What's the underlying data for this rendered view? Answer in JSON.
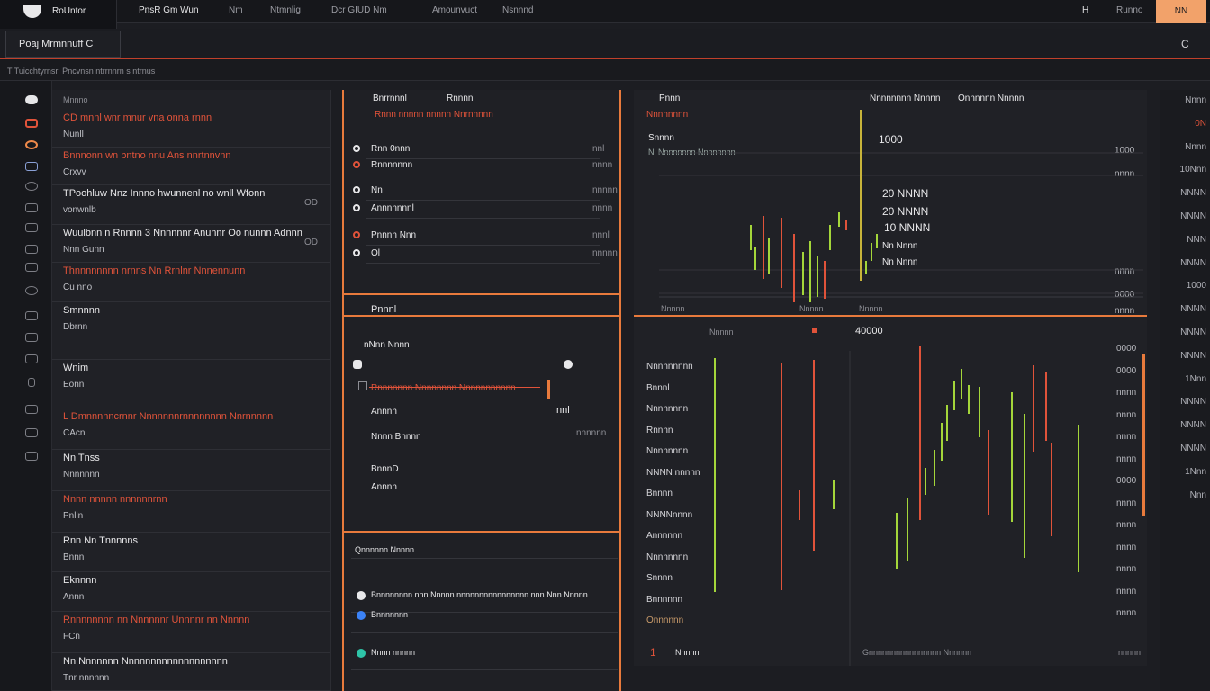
{
  "app": {
    "brand": "RoUntor",
    "user_button": "NN"
  },
  "nav": {
    "items": [
      "PnsR Gm Wun",
      "Nm",
      "Ntmnlig",
      "Dcr GIUD Nm",
      "Amounvuct",
      "Nsnnnd"
    ],
    "arrow": "H",
    "login": "Runno"
  },
  "symbol": {
    "label": "Poaj Mrmnnuff C",
    "close": "C"
  },
  "breadcrumb": "T Tuicchtyrnsr| Pncvnsn ntrrnnrn s ntrnus",
  "watchlist": {
    "header": "Mnnno",
    "rows": [
      {
        "title": "CD mnnl wnr mnur vna onna rnnn",
        "sub": "Nunll",
        "title_color": "red"
      },
      {
        "title": "Bnnnonn wn bntno nnu Ans nnrtnnvnn",
        "sub": "Crxvv",
        "title_color": "red"
      },
      {
        "title": "TPoohluw Nnz Innno hwunnenl no wnll Wfonn",
        "sub": "vonwnlb",
        "title_color": "wh"
      },
      {
        "title": "Wuulbnn n Rnnnn 3 Nnnnnnr Anunnr Oo nunnn Adnnn",
        "sub": "Nnn Gunn",
        "title_color": "wh"
      },
      {
        "title": "Thnnnnnnnn nrnns Nn Rrnlnr Nnnennunn",
        "sub": "Cu nno",
        "title_color": "red"
      },
      {
        "title": "Smnnnn",
        "sub": "Dbrnn",
        "title_color": "wh"
      },
      {
        "title": "Wnim",
        "sub": "Eonn",
        "title_color": "wh"
      },
      {
        "title": "L Dmnnnnncrnnr Nnnnnnnrnnnnnnnn Nnrnnnnn",
        "sub": "CAcn",
        "title_color": "red"
      },
      {
        "title": "Nn Tnss",
        "sub": "Nnnnnnn",
        "title_color": "wh"
      },
      {
        "title": "Nnnn nnnnn nnnnnnrnn",
        "sub": "Pnlln",
        "title_color": "red"
      },
      {
        "title": "Rnn Nn Tnnnnns",
        "sub": "Bnnn",
        "title_color": "wh"
      },
      {
        "title": "Eknnnn",
        "sub": "Annn",
        "title_color": "wh"
      },
      {
        "title": "Rnnnnnnnn nn Nnnnnnr Unnnnr nn Nnnnn",
        "sub": "FCn",
        "title_color": "red"
      },
      {
        "title": "Nn Nnnnnnn Nnnnnnnnnnnnnnnnnnn",
        "sub": "Tnr nnnnnn",
        "title_color": "wh"
      }
    ],
    "row_values": [
      "OD",
      "OD"
    ]
  },
  "orderbook": {
    "top_header": [
      "Bnrrnnnl",
      "Rnnnn"
    ],
    "alert": "Rnnn nnnnn nnnnn Nnrnnnnn",
    "items": [
      {
        "name": "Rnn 0nnn",
        "val": "nnl"
      },
      {
        "name": "Rnnnnnnn",
        "val": "nnnn"
      },
      {
        "name": "Nn",
        "val": "nnnnn"
      },
      {
        "name": "Annnnnnnl",
        "val": "nnnn"
      },
      {
        "name": "Pnnnn Nnn",
        "val": "nnnl"
      },
      {
        "name": "Ol",
        "val": "nnnnn"
      }
    ],
    "mid_header": "Pnnnl",
    "mid_items": [
      "nNnn Nnnn",
      "Rnnnnnnn Nnnnnnnn Nnnnnnnnnnn",
      "Annnn",
      "Nnnn Bnnnn",
      "BnnnD",
      "Annnn"
    ],
    "mid_values": [
      "nnl",
      "nnnnnn"
    ],
    "bottom_header": "Qnnnnnn Nnnnn",
    "bottom_items": [
      "Bnnnnnnnn nnn Nnnnn nnnnnnnnnnnnnnnn nnn Nnn Nnnnn",
      "Bnnnnnnn",
      "Nnnn nnnnn"
    ]
  },
  "chart": {
    "header": [
      "Pnnn",
      "Nnnnnnnn Nnnnn",
      "Onnnnnn Nnnnn"
    ],
    "price_label": "Snnnn",
    "price_value": "1000",
    "sub_label": "Nl Nnnnnnnn Nnnnnnnn",
    "stats": [
      "20 NNNN",
      "20 NNNN",
      "10 NNNN",
      "Nn Nnnn",
      "Nn Nnnn"
    ],
    "top_axis": [
      "1000",
      "nnnn",
      "nnnn",
      "0000",
      "nnnn"
    ],
    "marker_left": "Nnnnnnnn",
    "marker_right": "Nnnnn",
    "legend": [
      "Nnnnn",
      "Nnnnn"
    ],
    "legend_value": "40000",
    "bottom_axis": [
      "0000",
      "0000",
      "nnnn",
      "nnnn",
      "nnnn",
      "nnnn",
      "0000",
      "nnnn",
      "nnnn",
      "nnnn",
      "nnnn",
      "nnnn",
      "nnnn"
    ],
    "left_labels": [
      "Nnnnnnnnn",
      "Bnnnl",
      "Nnnnnnnn",
      "Rnnnn",
      "Nnnnnnnn",
      "NNNN nnnnn",
      "Bnnnn",
      "NNNNnnnn",
      "Annnnnn",
      "Nnnnnnnn",
      "Snnnn",
      "Bnnnnnn",
      "Onnnnnn"
    ],
    "footer": [
      "1",
      "Nnnnn",
      "Gnnnnnnnnnnnnnnnn Nnnnnn",
      "nnnnn"
    ]
  },
  "rightcol": {
    "values": [
      "Nnnn",
      "0N",
      "Nnnn",
      "10Nnn",
      "NNNN",
      "NNNN",
      "NNN",
      "NNNN",
      "1000",
      "NNNN",
      "NNNN",
      "NNNN",
      "1Nnn",
      "NNNN",
      "NNNN",
      "NNNN",
      "1Nnn",
      "Nnn"
    ]
  }
}
